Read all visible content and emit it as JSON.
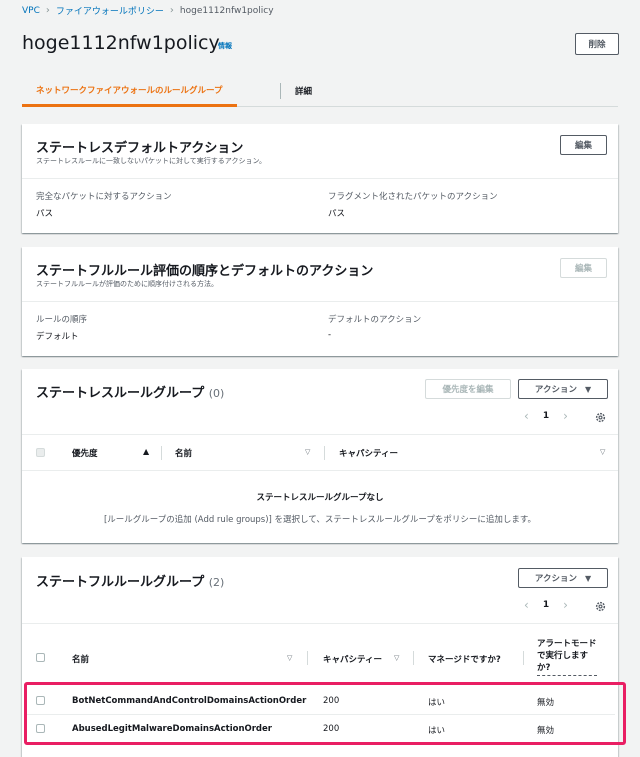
{
  "breadcrumb": {
    "items": [
      "VPC",
      "ファイアウォールポリシー"
    ],
    "current": "hoge1112nfw1policy"
  },
  "header": {
    "title": "hoge1112nfw1policy",
    "info_label": "情報",
    "delete_label": "削除"
  },
  "tabs": {
    "active": "ネットワークファイアウォールのルールグループ",
    "details": "詳細"
  },
  "stateless_default": {
    "title": "ステートレスデフォルトアクション",
    "description": "ステートレスルールに一致しないパケットに対して実行するアクション。",
    "edit_label": "編集",
    "full_packet_label": "完全なパケットに対するアクション",
    "full_packet_value": "パス",
    "fragment_label": "フラグメント化されたパケットのアクション",
    "fragment_value": "パス"
  },
  "stateful_eval": {
    "title": "ステートフルルール評価の順序とデフォルトのアクション",
    "description": "ステートフルルールが評価のために順序付けされる方法。",
    "edit_label": "編集",
    "order_label": "ルールの順序",
    "order_value": "デフォルト",
    "default_action_label": "デフォルトのアクション",
    "default_action_value": "-"
  },
  "stateless_groups": {
    "title": "ステートレスルールグループ",
    "count": "(0)",
    "edit_priority_label": "優先度を編集",
    "actions_label": "アクション",
    "page": "1",
    "columns": [
      "優先度",
      "名前",
      "キャパシティー"
    ],
    "empty_title": "ステートレスルールグループなし",
    "empty_desc": "[ルールグループの追加 (Add rule groups)] を選択して、ステートレスルールグループをポリシーに追加します。"
  },
  "stateful_groups": {
    "title": "ステートフルルールグループ",
    "count": "(2)",
    "actions_label": "アクション",
    "page": "1",
    "columns": {
      "name": "名前",
      "capacity": "キャパシティー",
      "managed": "マネージドですか?",
      "alert_line1": "アラートモード",
      "alert_line2": "で実行します",
      "alert_line3": "か?"
    },
    "rows": [
      {
        "name": "BotNetCommandAndControlDomainsActionOrder",
        "capacity": "200",
        "managed": "はい",
        "alert": "無効"
      },
      {
        "name": "AbusedLegitMalwareDomainsActionOrder",
        "capacity": "200",
        "managed": "はい",
        "alert": "無効"
      }
    ]
  },
  "colors": {
    "link": "#0073bb",
    "active_tab": "#ec7211",
    "highlight": "#e91e63"
  }
}
